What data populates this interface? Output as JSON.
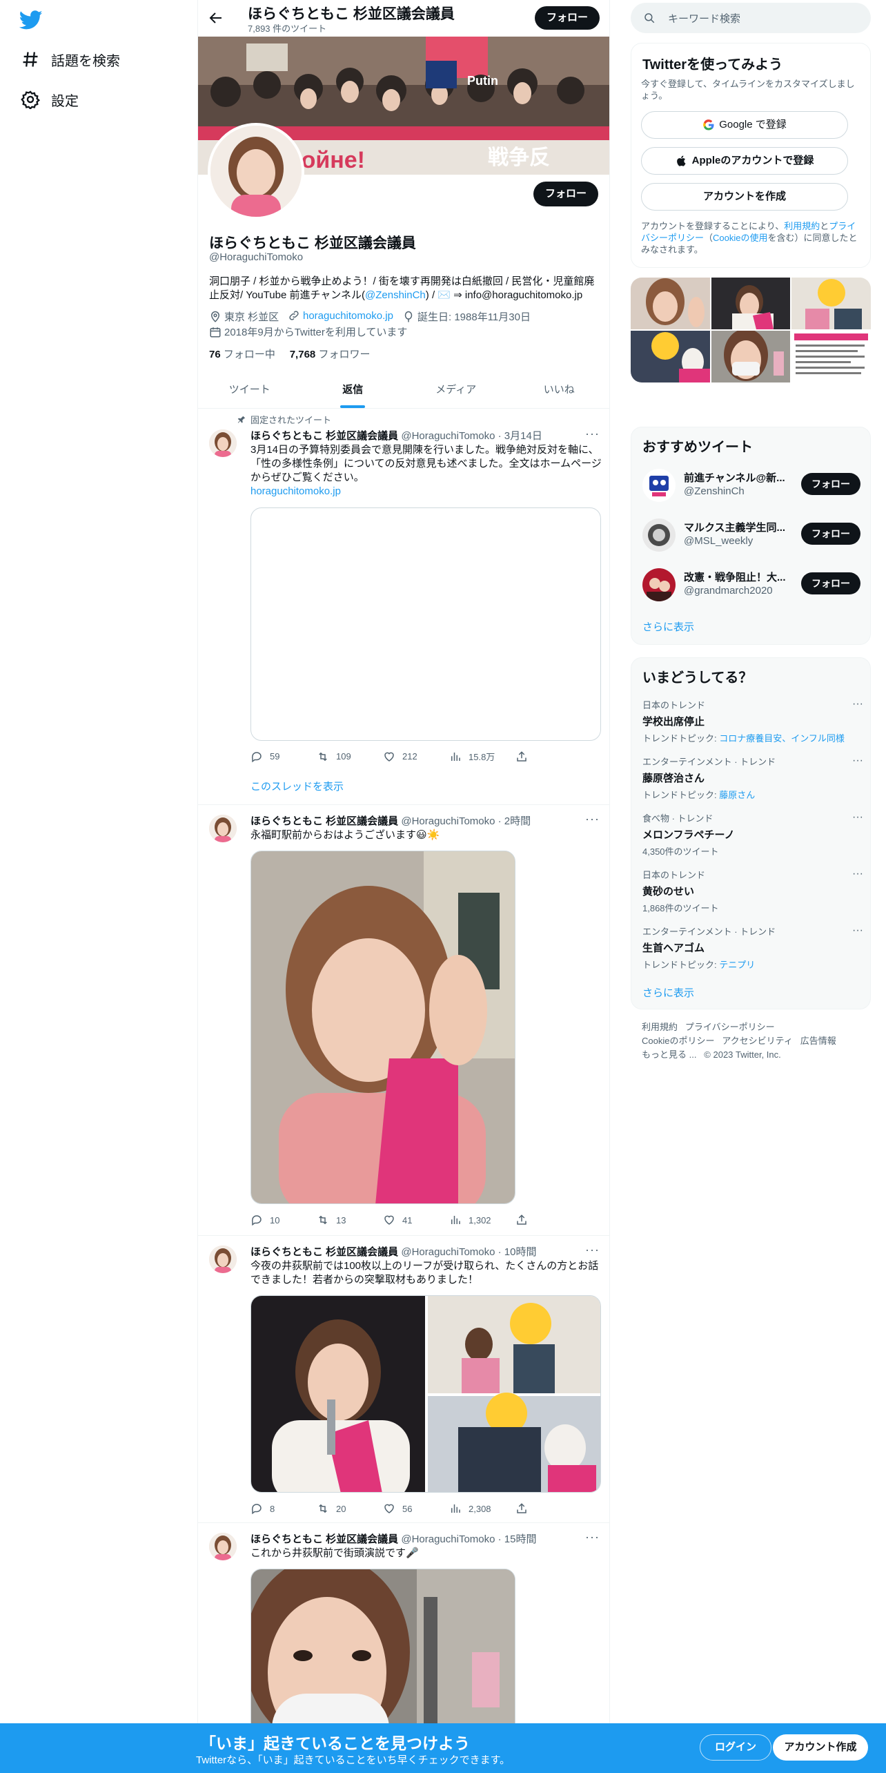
{
  "nav": {
    "explore_label": "話題を検索",
    "settings_label": "設定"
  },
  "header": {
    "name": "ほらぐちともこ 杉並区議会議員",
    "tweet_count": "7,893 件のツイート",
    "follow_label": "フォロー"
  },
  "profile": {
    "name": "ほらぐちともこ 杉並区議会議員",
    "handle": "@HoraguchiTomoko",
    "follow_label": "フォロー",
    "bio_1": "洞口朋子 / 杉並から戦争止めよう！/ 街を壊す再開発は白紙撤回 / 民営化・児童館廃止反対/ YouTube 前進チャンネル(",
    "bio_link": "@ZenshinCh",
    "bio_2": ") / ✉️ ⇒ info@horaguchitomoko.jp",
    "location": "東京 杉並区",
    "website": "horaguchitomoko.jp",
    "birthday": "誕生日: 1988年11月30日",
    "joined": "2018年9月からTwitterを利用しています",
    "following_count": "76",
    "following_label": "フォロー中",
    "followers_count": "7,768",
    "followers_label": "フォロワー"
  },
  "banner_signs": {
    "text_1": "Нет войне!",
    "text_2": "戦争反",
    "text_3": "Putin"
  },
  "tabs": [
    {
      "label": "ツイート"
    },
    {
      "label": "返信"
    },
    {
      "label": "メディア"
    },
    {
      "label": "いいね"
    }
  ],
  "tweets": [
    {
      "pinned_label": "固定されたツイート",
      "name": "ほらぐちともこ 杉並区議会議員",
      "handle_time": "@HoraguchiTomoko · 3月14日",
      "text": "3月14日の予算特別委員会で意見開陳を行いました。戦争絶対反対を軸に、「性の多様性条例」についての反対意見も述べました。全文はホームページからぜひご覧ください。",
      "link": "horaguchitomoko.jp",
      "replies": "59",
      "retweets": "109",
      "likes": "212",
      "views": "15.8万",
      "thread_label": "このスレッドを表示"
    },
    {
      "name": "ほらぐちともこ 杉並区議会議員",
      "handle_time": "@HoraguchiTomoko · 2時間",
      "text": "永福町駅前からおはようございます😃☀️",
      "replies": "10",
      "retweets": "13",
      "likes": "41",
      "views": "1,302"
    },
    {
      "name": "ほらぐちともこ 杉並区議会議員",
      "handle_time": "@HoraguchiTomoko · 10時間",
      "text": "今夜の井荻駅前では100枚以上のリーフが受け取られ、たくさんの方とお話できました！若者からの突撃取材もありました！",
      "replies": "8",
      "retweets": "20",
      "likes": "56",
      "views": "2,308"
    },
    {
      "name": "ほらぐちともこ 杉並区議会議員",
      "handle_time": "@HoraguchiTomoko · 15時間",
      "text": "これから井荻駅前で街頭演説です🎤"
    }
  ],
  "right": {
    "search_placeholder": "キーワード検索",
    "signup_title": "Twitterを使ってみよう",
    "signup_sub": "今すぐ登録して、タイムラインをカスタマイズしましょう。",
    "google_label": "Google で登録",
    "apple_label": "Appleのアカウントで登録",
    "create_label": "アカウントを作成",
    "terms_1": "アカウントを登録することにより、",
    "terms_link_1": "利用規約",
    "terms_2": "と",
    "terms_link_2": "プライバシーポリシー",
    "terms_3": "（",
    "terms_link_3": "Cookieの使用",
    "terms_4": "を含む）に同意したとみなされます。",
    "rec_title": "おすすめツイート",
    "recs": [
      {
        "name": "前進チャンネル@新...",
        "handle": "@ZenshinCh"
      },
      {
        "name": "マルクス主義学生同...",
        "handle": "@MSL_weekly"
      },
      {
        "name": "改憲・戦争阻止！大...",
        "handle": "@grandmarch2020"
      }
    ],
    "rec_follow_label": "フォロー",
    "show_more": "さらに表示",
    "trend_title": "いまどうしてる？",
    "trends": [
      {
        "cat": "日本のトレンド",
        "name": "学校出席停止",
        "meta_prefix": "トレンドトピック: ",
        "meta_link": "コロナ療養目安、インフル同様"
      },
      {
        "cat": "エンターテインメント · トレンド",
        "name": "藤原啓治さん",
        "meta_prefix": "トレンドトピック: ",
        "meta_link": "藤原さん"
      },
      {
        "cat": "食べ物 · トレンド",
        "name": "メロンフラペチーノ",
        "meta": "4,350件のツイート"
      },
      {
        "cat": "日本のトレンド",
        "name": "黄砂のせい",
        "meta": "1,868件のツイート"
      },
      {
        "cat": "エンターテインメント · トレンド",
        "name": "生首ヘアゴム",
        "meta_prefix": "トレンドトピック: ",
        "meta_link": "テニプリ"
      }
    ],
    "footer": {
      "terms": "利用規約",
      "privacy": "プライバシーポリシー",
      "cookie": "Cookieのポリシー",
      "accessibility": "アクセシビリティ",
      "ads": "広告情報",
      "more": "もっと見る ...",
      "copyright": "© 2023 Twitter, Inc."
    }
  },
  "bottom": {
    "title": "「いま」起きていることを見つけよう",
    "sub": "Twitterなら、「いま」起きていることをいち早くチェックできます。",
    "login": "ログイン",
    "signup": "アカウント作成"
  },
  "colors": {
    "accent": "#1d9bf0",
    "dark": "#0f1419",
    "muted": "#536471"
  }
}
